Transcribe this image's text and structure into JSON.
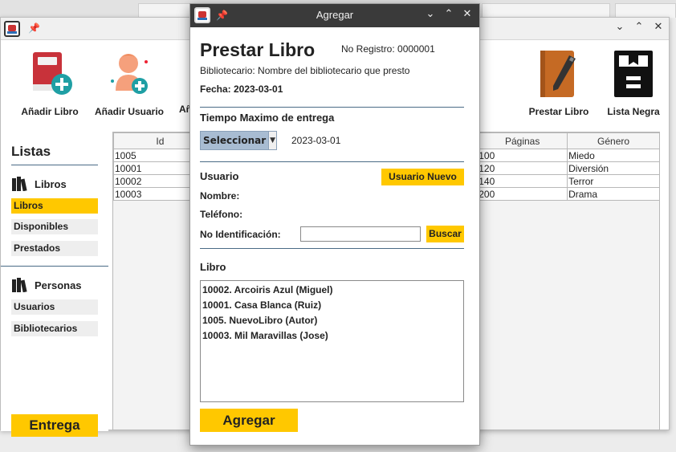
{
  "main_window": {
    "toolbar": {
      "add_book": "Añadir Libro",
      "add_user": "Añadir Usuario",
      "third_partial": "Añ",
      "lend_book": "Prestar Libro",
      "blacklist": "Lista Negra"
    },
    "sidebar": {
      "heading": "Listas",
      "libros_group": "Libros",
      "libros_items": [
        "Libros",
        "Disponibles",
        "Prestados"
      ],
      "personas_group": "Personas",
      "personas_items": [
        "Usuarios",
        "Bibliotecarios"
      ],
      "entrega_button": "Entrega"
    },
    "table": {
      "columns": [
        "Id",
        "Páginas",
        "Género"
      ],
      "rows": [
        {
          "id": "1005",
          "paginas": "100",
          "genero": "Miedo"
        },
        {
          "id": "10001",
          "paginas": "120",
          "genero": "Diversión"
        },
        {
          "id": "10002",
          "paginas": "140",
          "genero": "Terror"
        },
        {
          "id": "10003",
          "paginas": "200",
          "genero": "Drama"
        }
      ]
    }
  },
  "dialog": {
    "title": "Agregar",
    "heading": "Prestar Libro",
    "registro": "No Registro: 0000001",
    "bibliotecario": "Bibliotecario: Nombre del bibliotecario que presto",
    "fecha": "Fecha: 2023-03-01",
    "tiempo_label": "Tiempo Maximo de entrega",
    "select_value": "Seleccionar",
    "select_date": "2023-03-01",
    "usuario_label": "Usuario",
    "usuario_nuevo_button": "Usuario Nuevo",
    "nombre_label": "Nombre:",
    "telefono_label": "Teléfono:",
    "identificacion_label": "No Identificación:",
    "identificacion_value": "",
    "buscar_button": "Buscar",
    "libro_label": "Libro",
    "books": [
      "10002.  Arcoiris Azul (Miguel)",
      "10001.  Casa Blanca (Ruiz)",
      "1005.  NuevoLibro (Autor)",
      "10003.  Mil Maravillas (Jose)"
    ],
    "agregar_button": "Agregar"
  },
  "colors": {
    "accent_yellow": "#ffc800",
    "divider_blue": "#4a6b86",
    "dialog_titlebar": "#3a3a3a"
  }
}
